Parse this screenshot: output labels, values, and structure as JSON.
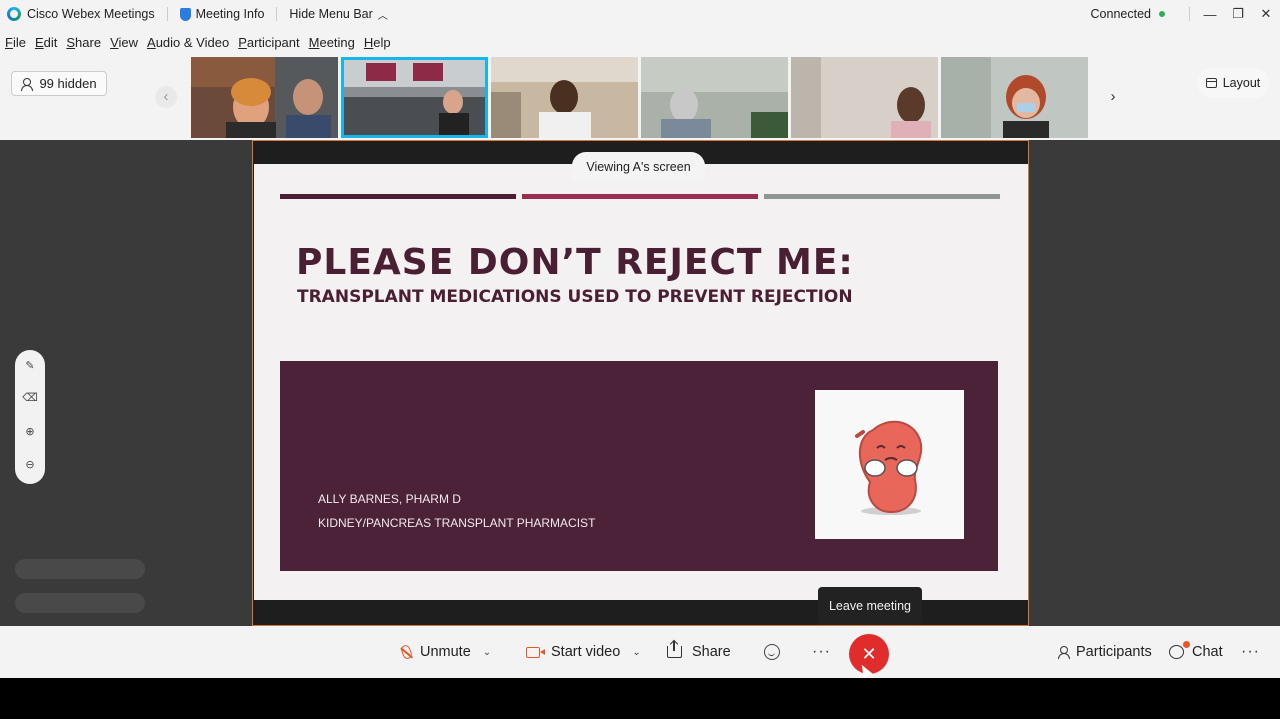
{
  "titlebar": {
    "app_name": "Cisco Webex Meetings",
    "meeting_info": "Meeting Info",
    "hide_menu_bar": "Hide Menu Bar",
    "status": "Connected"
  },
  "menu": [
    "File",
    "Edit",
    "Share",
    "View",
    "Audio & Video",
    "Participant",
    "Meeting",
    "Help"
  ],
  "strip": {
    "hidden_count": "99 hidden",
    "layout_label": "Layout"
  },
  "share": {
    "viewing_label": "Viewing A's screen"
  },
  "slide": {
    "title": "PLEASE DON’T REJECT ME:",
    "subtitle": "TRANSPLANT MEDICATIONS USED TO PREVENT REJECTION",
    "presenter_name": "ALLY BARNES, PHARM D",
    "presenter_role": "KIDNEY/PANCREAS TRANSPLANT PHARMACIST",
    "bar_colors": [
      "#4a1e33",
      "#9c2d52",
      "#8e9593"
    ]
  },
  "tooltip": "Leave meeting",
  "controls": {
    "unmute": "Unmute",
    "start_video": "Start video",
    "share": "Share",
    "participants": "Participants",
    "chat": "Chat"
  },
  "colors": {
    "accent": "#18b5e8",
    "leave": "#e12c2c",
    "muted": "#e05a2a",
    "connected": "#2fae4e"
  }
}
